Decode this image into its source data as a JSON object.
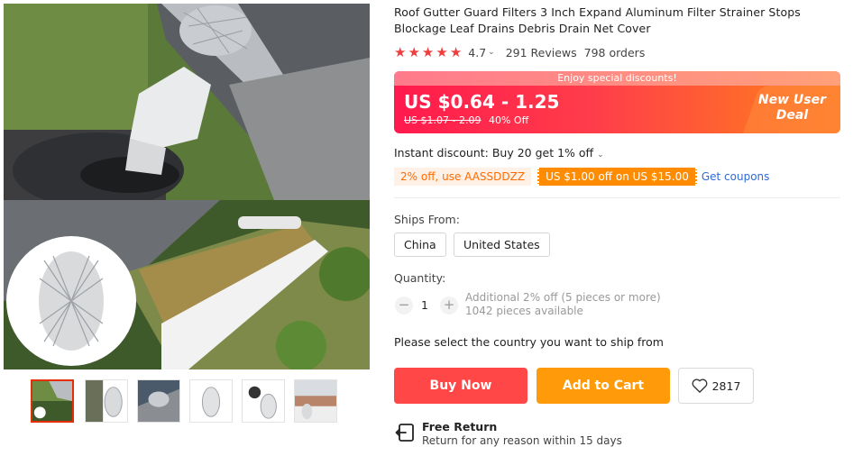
{
  "product": {
    "title": "Roof Gutter Guard Filters 3 Inch Expand Aluminum Filter Strainer Stops Blockage Leaf Drains Debris Drain Net Cover",
    "rating": {
      "stars": 5,
      "value": "4.7",
      "reviews": "291 Reviews",
      "orders": "798 orders"
    }
  },
  "gallery": {
    "thumbnails": [
      {
        "icon": "downspout-photo"
      },
      {
        "icon": "mesh-strainer-photo"
      },
      {
        "icon": "gutter-installed-photo"
      },
      {
        "icon": "mesh-cylinder-photo"
      },
      {
        "icon": "mesh-with-cap-photo"
      },
      {
        "icon": "roof-gutter-photo"
      }
    ],
    "active_index": 0
  },
  "pricing": {
    "banner_label": "Enjoy special discounts!",
    "price_range": "US $0.64 - 1.25",
    "original_price": "US $1.07 - 2.09",
    "discount": "40% Off",
    "new_user_line1": "New User",
    "new_user_line2": "Deal"
  },
  "discounts": {
    "instant": "Instant discount: Buy 20 get 1% off",
    "coupon_code": "2% off, use AASSDDZZ",
    "coupon_store": "US $1.00 off on US $15.00",
    "get_coupons": "Get coupons"
  },
  "shipping": {
    "label": "Ships From:",
    "options": [
      "China",
      "United States"
    ]
  },
  "quantity": {
    "label": "Quantity:",
    "minus": "−",
    "value": "1",
    "plus": "+",
    "note_line1": "Additional 2% off (5 pieces or more)",
    "note_line2": "1042 pieces available"
  },
  "ship_notice": "Please select the country you want to ship from",
  "actions": {
    "buy_now": "Buy Now",
    "add_to_cart": "Add to Cart",
    "wishlist_count": "2817"
  },
  "free_return": {
    "title": "Free Return",
    "subtitle": "Return for any reason within 15 days"
  },
  "colors": {
    "accent_red": "#ff4747",
    "accent_orange": "#ff9a0a",
    "link_blue": "#2e6bd6",
    "star_red": "#f03e3e"
  }
}
